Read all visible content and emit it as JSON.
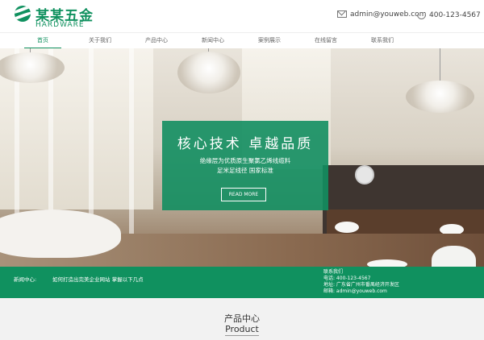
{
  "brand": {
    "name": "某某五金",
    "sub": "HARDWARE",
    "color": "#10915f"
  },
  "contact": {
    "email": "admin@youweb.com",
    "phone": "400-123-4567",
    "email_icon": "mail-icon",
    "phone_icon": "phone-icon"
  },
  "nav": {
    "items": [
      {
        "label": "首页",
        "active": true
      },
      {
        "label": "关于我们"
      },
      {
        "label": "产品中心"
      },
      {
        "label": "新闻中心"
      },
      {
        "label": "案例展示"
      },
      {
        "label": "在线留言"
      },
      {
        "label": "联系我们"
      }
    ]
  },
  "banner": {
    "title": "核心技术  卓越品质",
    "line1": "绝缘层为优质原生聚氯乙烯线缆料",
    "line2": "足米足线径  国家标准",
    "button": "READ MORE"
  },
  "info": {
    "news_label": "新闻中心:",
    "news_text": "如何打造出完美企业网站 掌握以下几点",
    "contact_title": "联系我们",
    "phone_line": "电话:  400-123-4567",
    "address_line": "地址:  广东省广州市番禺经济开发区",
    "email_line": "邮箱:  admin@youweb.com"
  },
  "section": {
    "title_cn": "产品中心",
    "title_en": "Product"
  }
}
